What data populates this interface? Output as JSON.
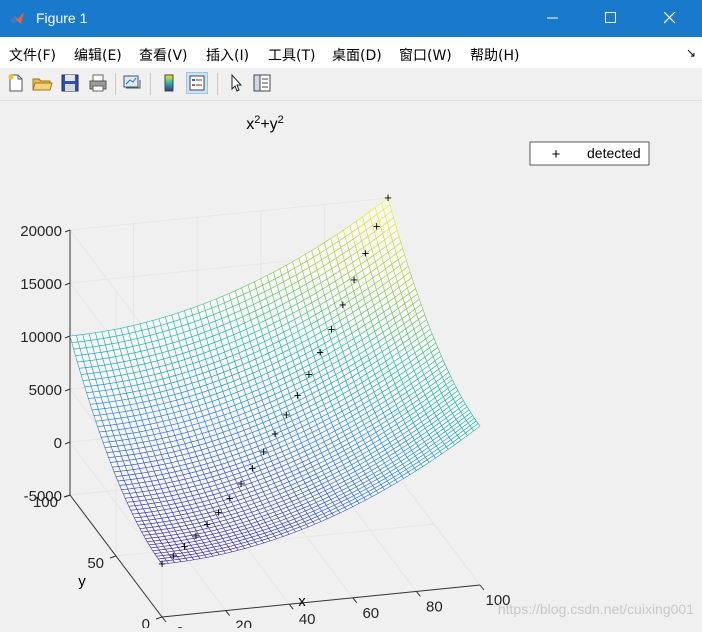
{
  "window": {
    "title": "Figure 1"
  },
  "menu": [
    "文件(F)",
    "编辑(E)",
    "查看(V)",
    "插入(I)",
    "工具(T)",
    "桌面(D)",
    "窗口(W)",
    "帮助(H)"
  ],
  "menu_right_glyph": "↘",
  "toolbar": [
    "new-figure-icon",
    "open-file-icon",
    "save-icon",
    "print-icon",
    "link-plot-icon",
    "colorbar-icon",
    "legend-icon",
    "pointer-icon",
    "property-editor-icon"
  ],
  "watermark": "https://blog.csdn.net/cuixing001",
  "chart_data": {
    "type": "surface",
    "title": "x²+y²",
    "xlabel": "x",
    "ylabel": "y",
    "zlabel": "",
    "xlim": [
      0,
      100
    ],
    "ylim": [
      0,
      100
    ],
    "zlim": [
      -5000,
      20000
    ],
    "x_ticks": [
      "0",
      "20",
      "40",
      "60",
      "80",
      "100"
    ],
    "y_ticks": [
      "0",
      "50",
      "100"
    ],
    "z_ticks": [
      "-5000",
      "0",
      "5000",
      "10000",
      "15000",
      "20000"
    ],
    "legend": {
      "entries": [
        {
          "label": "detected",
          "marker": "+",
          "color": "#000000"
        }
      ],
      "position": "top-right"
    },
    "series": [
      {
        "name": "surface",
        "function": "z = x^2 + y^2",
        "colormap": "parula"
      },
      {
        "name": "detected",
        "marker": "+",
        "x": [
          0,
          5,
          10,
          15,
          20,
          25,
          30,
          35,
          40,
          45,
          50,
          55,
          60,
          65,
          70,
          75,
          80,
          85,
          90,
          95,
          100
        ],
        "y": [
          0,
          5,
          10,
          15,
          20,
          25,
          30,
          35,
          40,
          45,
          50,
          55,
          60,
          65,
          70,
          75,
          80,
          85,
          90,
          95,
          100
        ],
        "z": [
          0,
          50,
          200,
          450,
          800,
          1250,
          1800,
          2450,
          3200,
          4050,
          5000,
          6050,
          7200,
          8450,
          9800,
          11250,
          12800,
          14450,
          16200,
          18050,
          20000
        ]
      }
    ],
    "grid": true
  }
}
